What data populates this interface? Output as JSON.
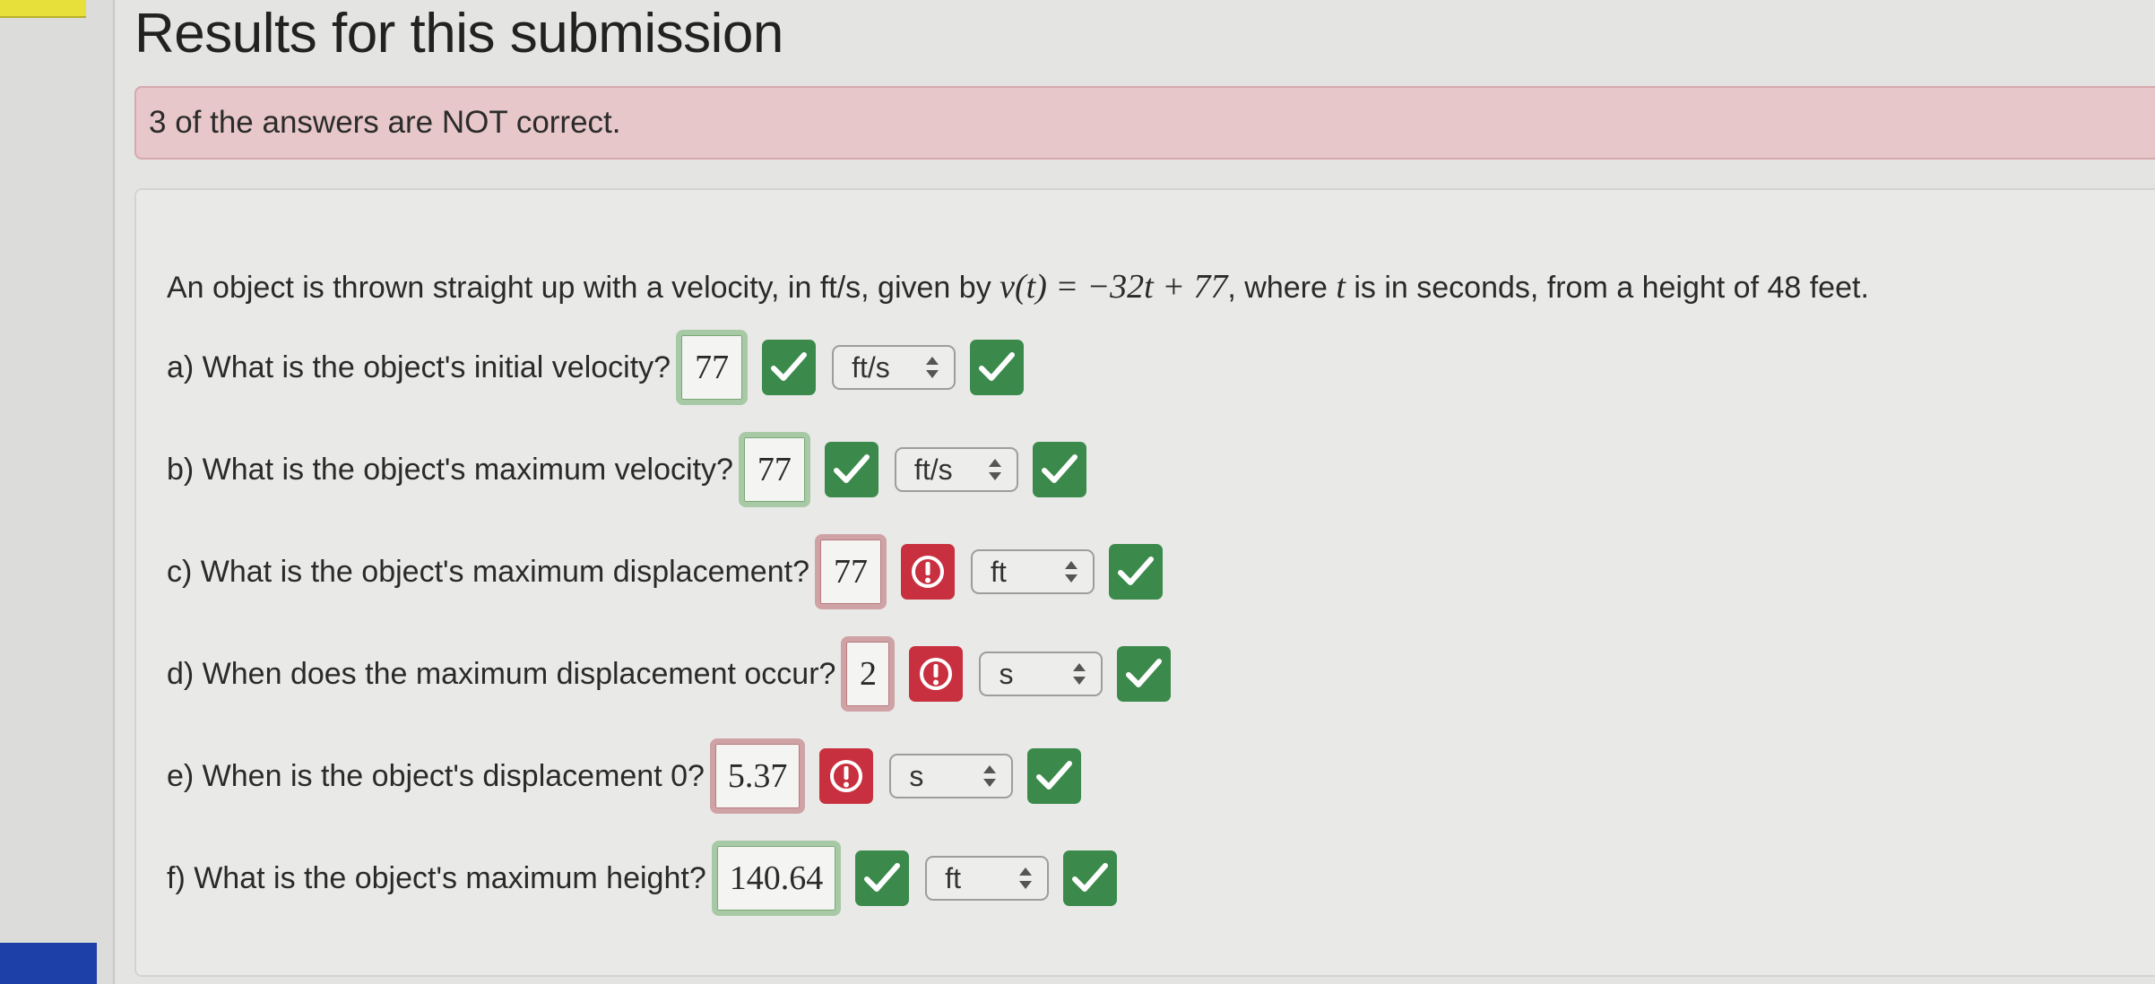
{
  "title": "Results for this submission",
  "alert": "3 of the answers are NOT correct.",
  "problem": {
    "prefix": "An object is thrown straight up with a velocity, in ft/s, given by",
    "equation": "v(t) = −32t + 77",
    "middle": ", where",
    "variable": "t",
    "suffix": "is in seconds, from a height of 48 feet."
  },
  "questions": [
    {
      "label": "a) What is the object's initial velocity?",
      "answer": "77",
      "answer_status": "correct",
      "unit": "ft/s",
      "unit_status": "correct"
    },
    {
      "label": "b) What is the object's maximum velocity?",
      "answer": "77",
      "answer_status": "correct",
      "unit": "ft/s",
      "unit_status": "correct"
    },
    {
      "label": "c) What is the object's maximum displacement?",
      "answer": "77",
      "answer_status": "incorrect",
      "unit": "ft",
      "unit_status": "correct"
    },
    {
      "label": "d) When does the maximum displacement occur?",
      "answer": "2",
      "answer_status": "incorrect",
      "unit": "s",
      "unit_status": "correct"
    },
    {
      "label": "e) When is the object's displacement 0?",
      "answer": "5.37",
      "answer_status": "incorrect",
      "unit": "s",
      "unit_status": "correct"
    },
    {
      "label": "f) What is the object's maximum height?",
      "answer": "140.64",
      "answer_status": "correct",
      "unit": "ft",
      "unit_status": "correct"
    }
  ],
  "icons": {
    "correct": "check-icon",
    "incorrect": "exclamation-circle-icon",
    "select": "up-down-arrows-icon"
  },
  "colors": {
    "correct": "#3b8a4c",
    "incorrect": "#c8303f",
    "alert_bg": "#e7c7c9"
  }
}
